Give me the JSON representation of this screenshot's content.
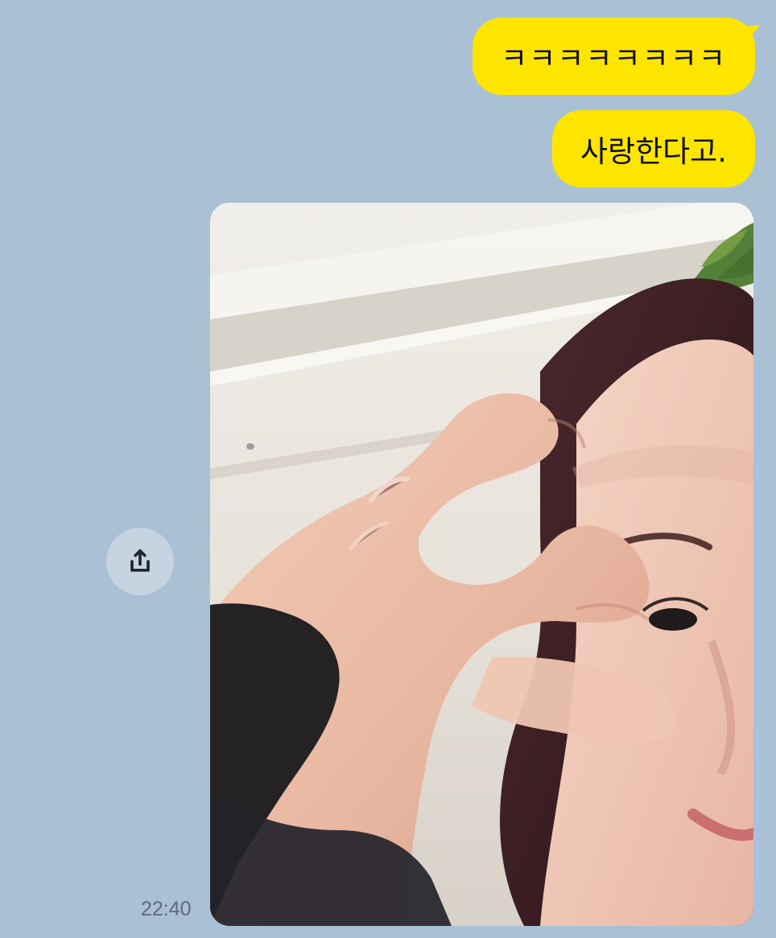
{
  "chat": {
    "messages": [
      {
        "text": "ㅋㅋㅋㅋㅋㅋㅋㅋ",
        "sender": "me"
      },
      {
        "text": "사랑한다고.",
        "sender": "me"
      }
    ],
    "photo": {
      "alt": ""
    },
    "share_icon": "share-icon",
    "timestamp": "22:40"
  },
  "colors": {
    "background": "#aac0d5",
    "bubble": "#fee500",
    "share_button": "#c6d4e2",
    "timestamp": "#5f6b78"
  }
}
